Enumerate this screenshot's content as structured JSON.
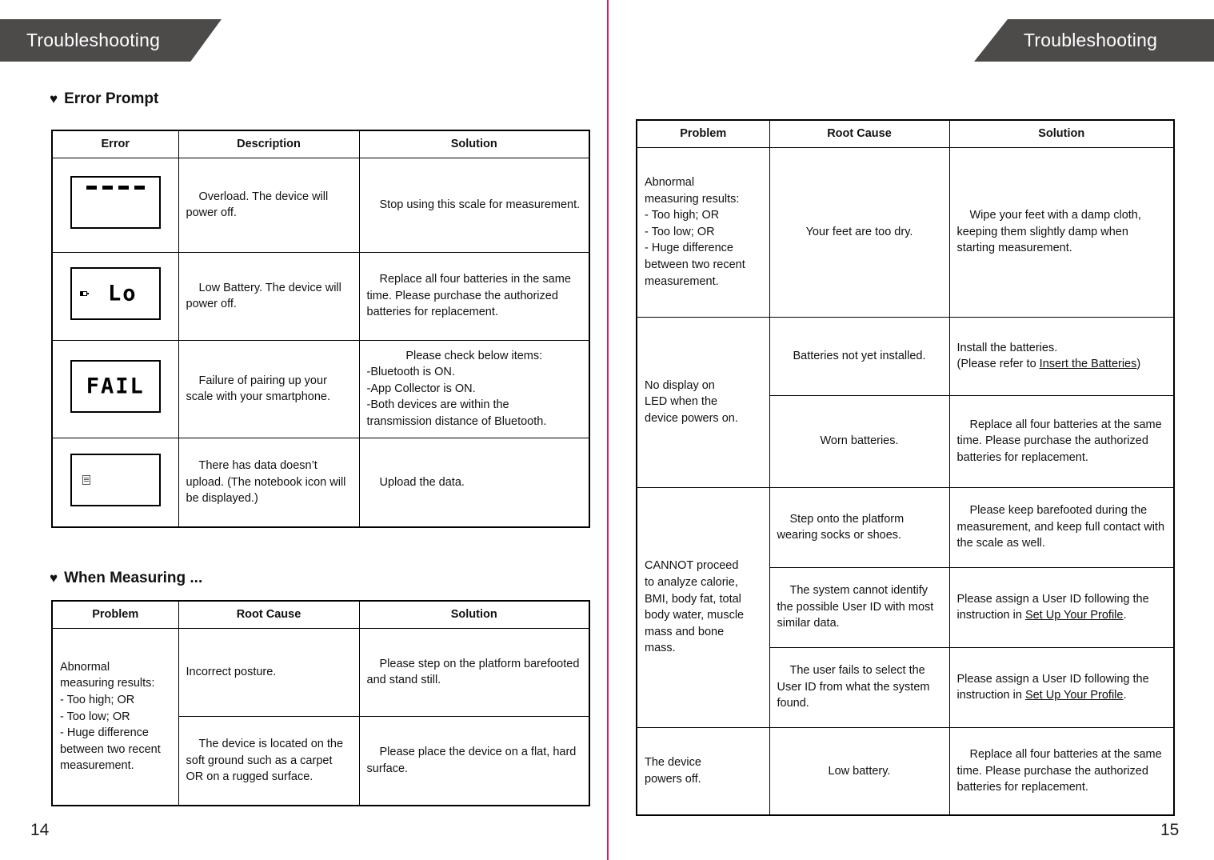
{
  "spread": {
    "divider_color": "#d81b60",
    "banner_color": "#4d4a4a"
  },
  "left_page": {
    "banner_title": "Troubleshooting",
    "page_number": "14",
    "sections": [
      {
        "bullet": "heart-bullet",
        "heading": "Error Prompt",
        "table": {
          "headers": [
            "Error",
            "Description",
            "Solution"
          ],
          "rows": [
            {
              "icon": "lcd-overload-dashes",
              "icon_text": "- - - -",
              "description": "Overload. The device will power off.",
              "solution": "Stop using this scale for measurement."
            },
            {
              "icon": "lcd-low-battery",
              "icon_text": "Lo",
              "description": "Low Battery. The device will power off.",
              "solution": "Replace all four batteries in the same time. Please purchase the authorized batteries for replacement."
            },
            {
              "icon": "lcd-fail",
              "icon_text": "FAIL",
              "description": "Failure of pairing up your scale with your smartphone.",
              "solution_lines": [
                "Please check below items:",
                "-Bluetooth is ON.",
                "-App Collector is ON.",
                "-Both devices are within the",
                "transmission distance of Bluetooth."
              ]
            },
            {
              "icon": "lcd-notebook-icon",
              "icon_text": "",
              "description": "There has data doesn’t upload. (The notebook icon will be displayed.)",
              "solution": "Upload the data."
            }
          ]
        }
      },
      {
        "bullet": "heart-bullet",
        "heading": "When Measuring ...",
        "table": {
          "headers": [
            "Problem",
            "Root Cause",
            "Solution"
          ],
          "problem_lines": [
            "Abnormal",
            "measuring results:",
            "   - Too high; OR",
            "   - Too low; OR",
            "   - Huge difference",
            "between two recent",
            "measurement."
          ],
          "rows": [
            {
              "root_cause": "Incorrect posture.",
              "solution": "Please step on the platform barefooted and stand still."
            },
            {
              "root_cause": "The device is located on the soft ground such as a carpet OR on a rugged surface.",
              "solution": "Please place the device on a flat, hard surface."
            }
          ]
        }
      }
    ]
  },
  "right_page": {
    "banner_title": "Troubleshooting",
    "page_number": "15",
    "table": {
      "headers": [
        "Problem",
        "Root Cause",
        "Solution"
      ],
      "groups": [
        {
          "problem_lines": [
            "Abnormal",
            "measuring results:",
            "   - Too high; OR",
            "   - Too low; OR",
            "   - Huge difference",
            "between two recent",
            "measurement."
          ],
          "rows": [
            {
              "root_cause": "Your feet are too dry.",
              "solution": "Wipe your feet with a damp cloth, keeping them slightly damp when starting measurement."
            }
          ]
        },
        {
          "problem_lines": [
            "   No display on",
            "LED when the",
            "device powers on."
          ],
          "rows": [
            {
              "root_cause": "Batteries not yet installed.",
              "solution_parts": [
                {
                  "text": "Install the batteries.",
                  "link": false,
                  "break_after": true
                },
                {
                  "text": "(Please refer to ",
                  "link": false
                },
                {
                  "text": "Insert the Batteries",
                  "link": true
                },
                {
                  "text": ")",
                  "link": false
                }
              ]
            },
            {
              "root_cause": "Worn batteries.",
              "solution": "Replace all four batteries at the same time. Please purchase the authorized batteries for replacement."
            }
          ]
        },
        {
          "problem_lines": [
            "   CANNOT proceed",
            "to analyze calorie,",
            "BMI, body fat, total",
            "body water, muscle",
            "mass and bone",
            "mass."
          ],
          "rows": [
            {
              "root_cause": "Step onto the platform wearing socks or shoes.",
              "solution": "Please keep barefooted during the measurement, and keep full contact with the scale as well."
            },
            {
              "root_cause": "The system cannot identify the possible User ID with most similar data.",
              "solution_parts": [
                {
                  "text": "Please assign a User ID following the instruction in ",
                  "link": false
                },
                {
                  "text": "Set Up Your Profile",
                  "link": true
                },
                {
                  "text": ".",
                  "link": false
                }
              ]
            },
            {
              "root_cause": "The user fails to select the User ID from what the system found.",
              "solution_parts": [
                {
                  "text": "Please assign a User ID following the instruction in ",
                  "link": false
                },
                {
                  "text": "Set Up Your Profile",
                  "link": true
                },
                {
                  "text": ".",
                  "link": false
                }
              ]
            }
          ]
        },
        {
          "problem_lines": [
            "   The device",
            "powers off."
          ],
          "rows": [
            {
              "root_cause": "Low battery.",
              "solution": "Replace all four batteries at the same time. Please purchase the authorized batteries for replacement."
            }
          ]
        }
      ]
    }
  }
}
